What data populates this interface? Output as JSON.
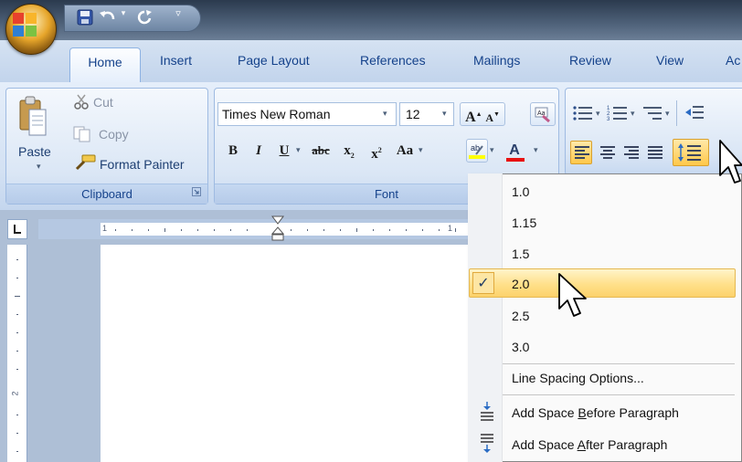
{
  "tabs": [
    "Home",
    "Insert",
    "Page Layout",
    "References",
    "Mailings",
    "Review",
    "View",
    "Ac"
  ],
  "clipboard": {
    "paste": "Paste",
    "cut": "Cut",
    "copy": "Copy",
    "format_painter": "Format Painter",
    "label": "Clipboard"
  },
  "font": {
    "name": "Times New Roman",
    "size": "12",
    "label": "Font",
    "bold": "B",
    "italic": "I",
    "underline": "U",
    "strike": "abc",
    "subscript": "x",
    "superscript": "x",
    "change_case": "Aa",
    "grow": "A",
    "shrink": "A",
    "text_color": "A"
  },
  "ruler": {
    "h_mark": "1",
    "v_mark": "2"
  },
  "menu": {
    "items": [
      "1.0",
      "1.15",
      "1.5",
      "2.0",
      "2.5",
      "3.0",
      "Line Spacing Options..."
    ],
    "selected": "2.0",
    "check": "✓",
    "add_before": {
      "pre": "Add Space ",
      "key": "B",
      "post": "efore Paragraph"
    },
    "add_after": {
      "pre": "Add Space ",
      "key": "A",
      "post": "fter Paragraph"
    }
  },
  "colors": {
    "highlight": "#ffe08a",
    "text_color": "#e81010",
    "highlight_yellow": "#ffff00"
  }
}
